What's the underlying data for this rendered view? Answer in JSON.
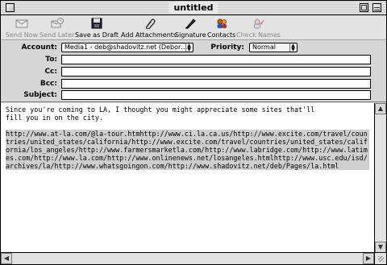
{
  "window": {
    "title": "untitled"
  },
  "toolbar": {
    "items": [
      {
        "label": "Send Now",
        "icon": "send-now-icon",
        "enabled": false
      },
      {
        "label": "Send Later",
        "icon": "send-later-icon",
        "enabled": false
      },
      {
        "label": "Save as Draft",
        "icon": "save-draft-icon",
        "enabled": true
      },
      {
        "label": "Add Attachments",
        "icon": "paperclip-icon",
        "enabled": true
      },
      {
        "label": "Signature",
        "icon": "signature-pen-icon",
        "enabled": true
      },
      {
        "label": "Contacts",
        "icon": "contacts-icon",
        "enabled": true
      },
      {
        "label": "Check Names",
        "icon": "check-names-icon",
        "enabled": false
      }
    ]
  },
  "header": {
    "account_label": "Account:",
    "account_value": "Media1 - deb@shadovitz.net (Debor…",
    "priority_label": "Priority:",
    "priority_value": "Normal",
    "to_label": "To:",
    "to_value": "",
    "cc_label": "Cc:",
    "cc_value": "",
    "bcc_label": "Bcc:",
    "bcc_value": "",
    "subject_label": "Subject:",
    "subject_value": ""
  },
  "message": {
    "intro": "Since you're coming to LA, I thought you might appreciate some sites that'll\nfill you in on the city.",
    "urls": "http://www.at-la.com/@la-tour.htmhttp://www.ci.la.ca.us/http://www.excite.com/travel/countries/united_states/california/http://www.excite.com/travel/countries/united_states/california/los_angeles/http://www.farmersmarketla.com/http://www.labridge.com/http://www.latimes.com/http://www.la.com/http://www.onlinenews.net/losangeles.htmlhttp://www.usc.edu/isd/archives/la/http://www.whatsgoingon.com/http://www.shadovitz.net/deb/Pages/la.html"
  },
  "colors": {
    "window_bg": "#dddddd",
    "selection": "#cfcfcf",
    "link_underline": "#cc0000"
  }
}
